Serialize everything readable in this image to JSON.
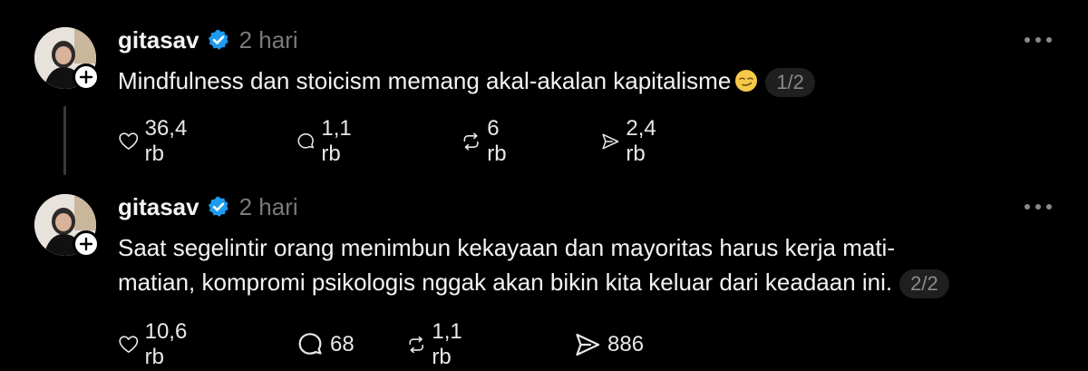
{
  "posts": [
    {
      "username": "gitasav",
      "time": "2 hari",
      "text": "Mindfulness dan stoicism memang akal-akalan kapitalisme",
      "emoji": "smirk-face-emoji",
      "page": "1/2",
      "stats": {
        "likes": "36,4 rb",
        "replies": "1,1 rb",
        "reposts": "6 rb",
        "shares": "2,4 rb"
      }
    },
    {
      "username": "gitasav",
      "time": "2 hari",
      "text_line1": "Saat segelintir orang menimbun kekayaan dan mayoritas harus kerja mati-",
      "text_line2": "matian, kompromi psikologis nggak akan bikin kita keluar dari keadaan ini.",
      "page": "2/2",
      "stats": {
        "likes": "10,6 rb",
        "replies": "68",
        "reposts": "1,1 rb",
        "shares": "886"
      }
    }
  ],
  "colors": {
    "background": "#000000",
    "text": "#f3f3f3",
    "muted": "#7a7a7a",
    "verified": "#1d9bf0"
  },
  "icons": [
    "heart-icon",
    "comment-icon",
    "repost-icon",
    "share-icon",
    "verified-icon",
    "plus-icon",
    "more-icon"
  ]
}
